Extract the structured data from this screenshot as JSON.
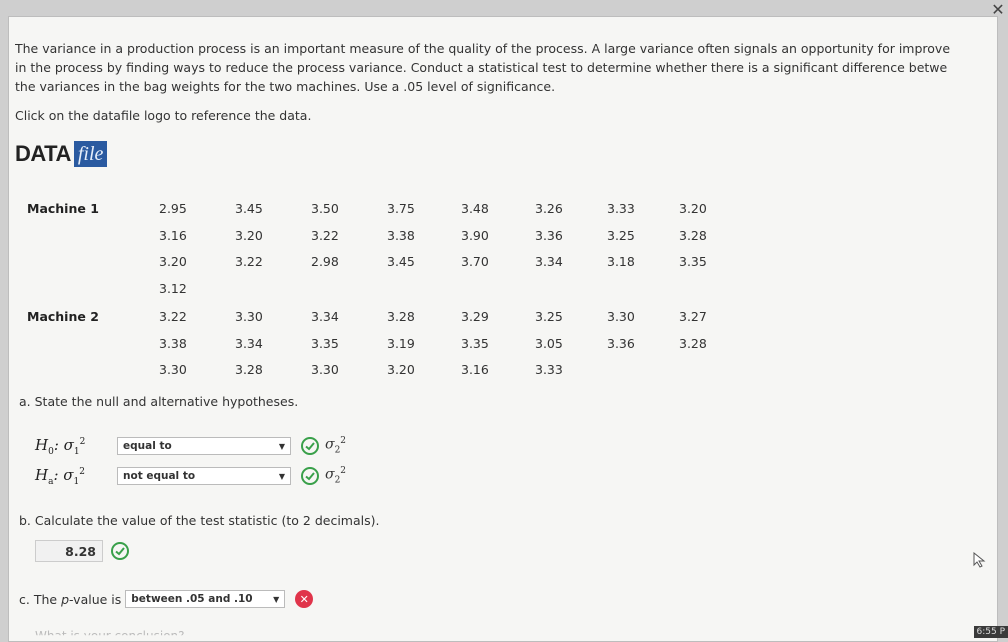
{
  "intro": {
    "lines": [
      "The variance in a production process is an important measure of the quality of the process. A large variance often signals an opportunity for improve",
      "in the process by finding ways to reduce the process variance. Conduct a statistical test to determine whether there is a significant difference betwe",
      "the variances in the bag weights for the two machines. Use a .05 level of significance."
    ],
    "reference": "Click on the datafile logo to reference the data."
  },
  "datafile": {
    "data": "DATA",
    "file": "file"
  },
  "machines": [
    {
      "label": "Machine 1",
      "rows": [
        [
          "2.95",
          "3.45",
          "3.50",
          "3.75",
          "3.48",
          "3.26",
          "3.33",
          "3.20"
        ],
        [
          "3.16",
          "3.20",
          "3.22",
          "3.38",
          "3.90",
          "3.36",
          "3.25",
          "3.28"
        ],
        [
          "3.20",
          "3.22",
          "2.98",
          "3.45",
          "3.70",
          "3.34",
          "3.18",
          "3.35"
        ],
        [
          "3.12"
        ]
      ]
    },
    {
      "label": "Machine 2",
      "rows": [
        [
          "3.22",
          "3.30",
          "3.34",
          "3.28",
          "3.29",
          "3.25",
          "3.30",
          "3.27"
        ],
        [
          "3.38",
          "3.34",
          "3.35",
          "3.19",
          "3.35",
          "3.05",
          "3.36",
          "3.28"
        ],
        [
          "3.30",
          "3.28",
          "3.30",
          "3.20",
          "3.16",
          "3.33"
        ]
      ]
    }
  ],
  "part_a": {
    "prompt": "a. State the null and alternative hypotheses.",
    "h0": {
      "label": "H",
      "sub": "0",
      "sep": ": σ",
      "sigma_sub": "1",
      "sup": "2",
      "selected": "equal to",
      "rhs": "σ",
      "rhs_sub": "2",
      "rhs_sup": "2"
    },
    "ha": {
      "label": "H",
      "sub": "a",
      "sep": ": σ",
      "sigma_sub": "1",
      "sup": "2",
      "selected": "not equal to",
      "rhs": "σ",
      "rhs_sub": "2",
      "rhs_sup": "2"
    }
  },
  "part_b": {
    "prompt": "b. Calculate the value of the test statistic (to 2 decimals).",
    "answer": "8.28"
  },
  "part_c": {
    "prompt_prefix": "c. The",
    "prompt_italic": "p",
    "prompt_suffix": "-value is",
    "selected": "between .05 and .10"
  },
  "cut_text": "What is your conclusion?",
  "clock": "6:55 P",
  "colors": {
    "check": "#39a04a",
    "wrong": "#e0344a",
    "datafile_bg": "#2a5aa0"
  },
  "icons": {
    "correct": "check-circle-icon",
    "incorrect": "x-circle-icon",
    "dropdown": "triangle-down-icon"
  }
}
